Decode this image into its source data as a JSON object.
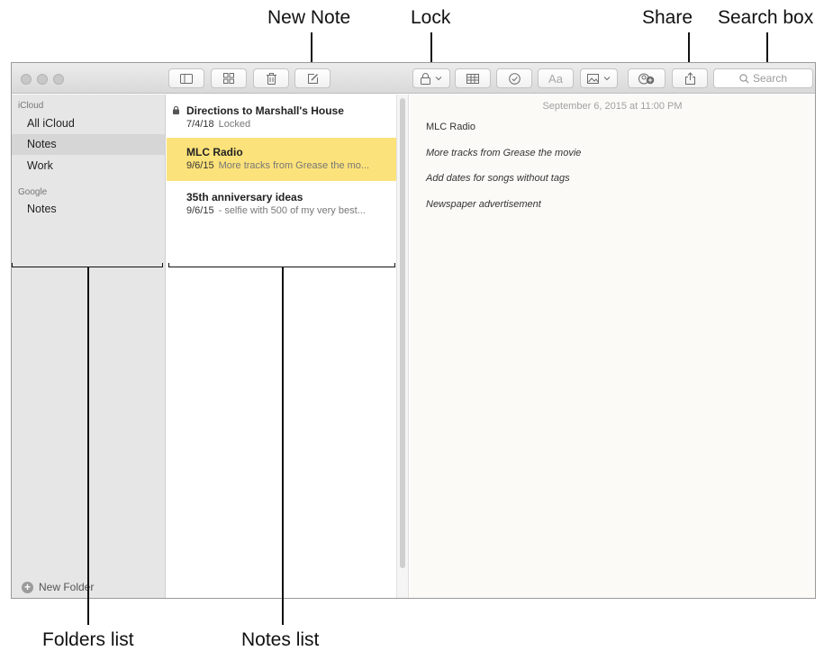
{
  "callouts": {
    "new_note": "New Note",
    "lock": "Lock",
    "share": "Share",
    "search_box": "Search box",
    "folders_list": "Folders list",
    "notes_list": "Notes list"
  },
  "toolbar": {
    "format_label": "Aa",
    "search_placeholder": "Search"
  },
  "sidebar": {
    "accounts": [
      {
        "name": "iCloud",
        "folders": [
          "All iCloud",
          "Notes",
          "Work"
        ],
        "selected": "Notes"
      },
      {
        "name": "Google",
        "folders": [
          "Notes"
        ]
      }
    ],
    "new_folder": "New Folder"
  },
  "notes": [
    {
      "title": "Directions to Marshall's House",
      "date": "7/4/18",
      "preview": "Locked",
      "locked": true
    },
    {
      "title": "MLC Radio",
      "date": "9/6/15",
      "preview": "More tracks from Grease the mo...",
      "selected": true
    },
    {
      "title": "35th anniversary ideas",
      "date": "9/6/15",
      "preview": "- selfie with 500 of my very best..."
    }
  ],
  "editor": {
    "date": "September 6, 2015 at 11:00 PM",
    "lines": [
      "MLC Radio",
      "More tracks from Grease the movie",
      "Add dates for songs without tags",
      "Newspaper advertisement"
    ]
  },
  "colors": {
    "selected_note": "#fce27a",
    "sidebar": "#e6e6e6",
    "toolbar": "#dedede"
  }
}
